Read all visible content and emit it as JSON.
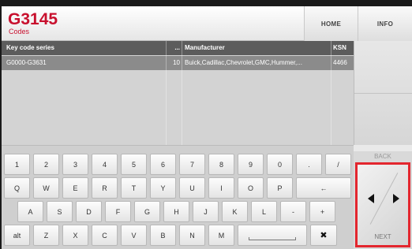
{
  "header": {
    "title": "G3145",
    "subtitle": "Codes",
    "home_label": "HOME",
    "info_label": "INFO"
  },
  "table": {
    "columns": {
      "series": "Key code series",
      "num": "...",
      "manufacturer": "Manufacturer",
      "ksn": "KSN"
    },
    "rows": [
      {
        "series": "G0000-G3631",
        "num": "10",
        "manufacturer": "Buick,Cadillac,Chevrolet,GMC,Hummer,...",
        "ksn": "4466"
      }
    ]
  },
  "keyboard": {
    "row1": [
      "1",
      "2",
      "3",
      "4",
      "5",
      "6",
      "7",
      "8",
      "9",
      "0",
      ".",
      "/"
    ],
    "row2": [
      "Q",
      "W",
      "E",
      "R",
      "T",
      "Y",
      "U",
      "I",
      "O",
      "P",
      "←"
    ],
    "row3": [
      "A",
      "S",
      "D",
      "F",
      "G",
      "H",
      "J",
      "K",
      "L",
      "-",
      "+"
    ],
    "row4": [
      "alt",
      "Z",
      "X",
      "C",
      "V",
      "B",
      "N",
      "M",
      "",
      "✖"
    ]
  },
  "nav": {
    "back_label": "BACK",
    "next_label": "NEXT",
    "prev_icon": "arrow-left-icon",
    "next_icon": "arrow-right-icon"
  },
  "colors": {
    "brand": "#c8102e",
    "highlight": "#e3262e",
    "table_header": "#5c5c5c",
    "selected_row": "#8b8b8b"
  }
}
